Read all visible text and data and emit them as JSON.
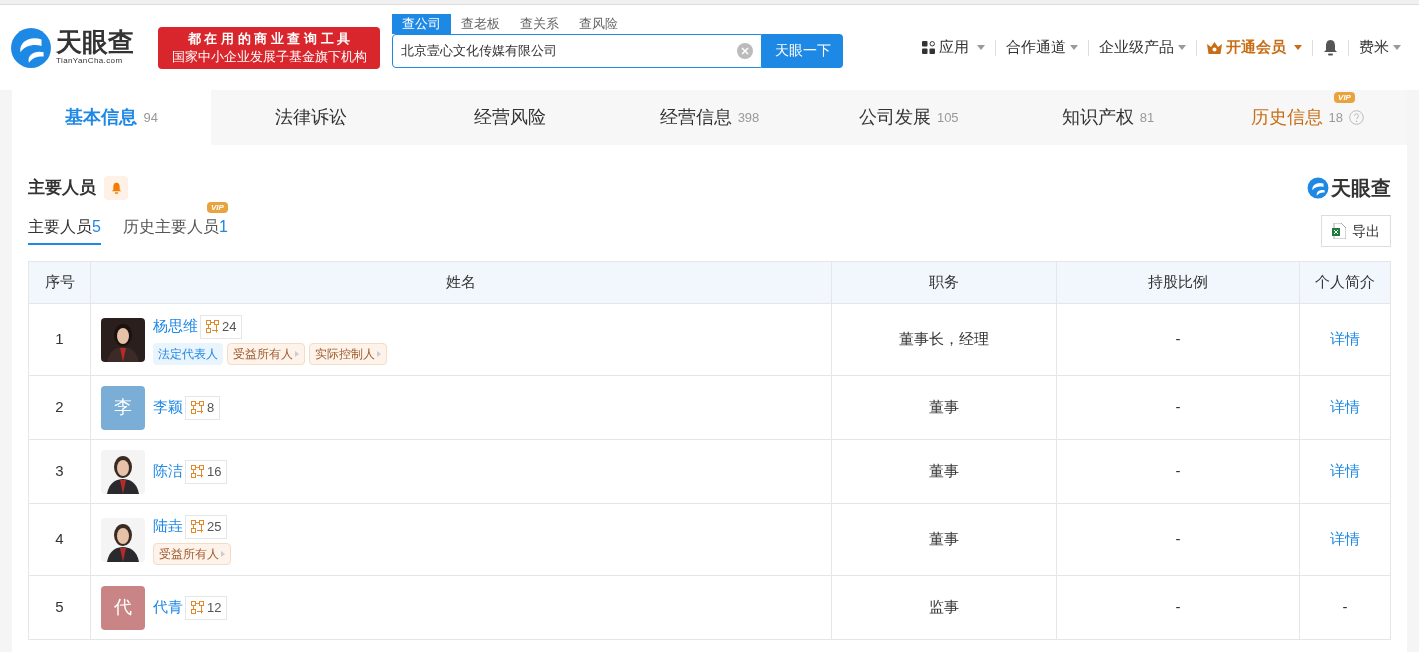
{
  "header": {
    "logo_text": "天眼查",
    "logo_domain": "TianYanCha.com",
    "banner": [
      "都 在 用 的 商 业 查 询 工 具",
      "国家中小企业发展子基金旗下机构"
    ],
    "search_tabs": [
      {
        "label": "查公司",
        "selected": true
      },
      {
        "label": "查老板",
        "selected": false
      },
      {
        "label": "查关系",
        "selected": false
      },
      {
        "label": "查风险",
        "selected": false
      }
    ],
    "search_value": "北京壹心文化传媒有限公司",
    "search_button": "天眼一下",
    "nav": [
      {
        "label": "应用",
        "kind": "apps"
      },
      {
        "label": "合作通道",
        "kind": "plain"
      },
      {
        "label": "企业级产品",
        "kind": "plain"
      },
      {
        "label": "开通会员",
        "kind": "vip"
      },
      {
        "kind": "bell"
      },
      {
        "label": "费米",
        "kind": "plain"
      }
    ]
  },
  "tabs": [
    {
      "label": "基本信息",
      "count": "94",
      "selected": true
    },
    {
      "label": "法律诉讼",
      "selected": false
    },
    {
      "label": "经营风险",
      "selected": false
    },
    {
      "label": "经营信息",
      "count": "398",
      "selected": false
    },
    {
      "label": "公司发展",
      "count": "105",
      "selected": false
    },
    {
      "label": "知识产权",
      "count": "81",
      "selected": false
    },
    {
      "label": "历史信息",
      "count": "18",
      "selected": false,
      "vip_badge": "VIP"
    }
  ],
  "section": {
    "title": "主要人员",
    "brand": "天眼查",
    "export": "导出",
    "subtabs": [
      {
        "label": "主要人员",
        "count": "5",
        "selected": true
      },
      {
        "label": "历史主要人员",
        "count": "1",
        "selected": false,
        "vip_badge": "VIP"
      }
    ],
    "table": {
      "columns": [
        "序号",
        "姓名",
        "职务",
        "持股比例",
        "个人简介"
      ],
      "rows": [
        {
          "index": "1",
          "avatar": {
            "kind": "picture"
          },
          "name": "杨思维",
          "relations": "24",
          "tags": [
            {
              "label": "法定代表人",
              "kind": "legal"
            },
            {
              "label": "受益所有人",
              "kind": "owner"
            },
            {
              "label": "实际控制人",
              "kind": "owner"
            }
          ],
          "position": "董事长，经理",
          "share": "-",
          "detail": "详情",
          "detail_link": true
        },
        {
          "index": "2",
          "avatar": {
            "kind": "initial",
            "text": "李",
            "color": "#7aaed6"
          },
          "name": "李颖",
          "relations": "8",
          "position": "董事",
          "share": "-",
          "detail": "详情",
          "detail_link": true
        },
        {
          "index": "3",
          "avatar": {
            "kind": "picture"
          },
          "name": "陈洁",
          "relations": "16",
          "position": "董事",
          "share": "-",
          "detail": "详情",
          "detail_link": true
        },
        {
          "index": "4",
          "avatar": {
            "kind": "picture"
          },
          "name": "陆垚",
          "relations": "25",
          "tags": [
            {
              "label": "受益所有人",
              "kind": "owner"
            }
          ],
          "position": "董事",
          "share": "-",
          "detail": "详情",
          "detail_link": true
        },
        {
          "index": "5",
          "avatar": {
            "kind": "initial",
            "text": "代",
            "color": "#c98585"
          },
          "name": "代青",
          "relations": "12",
          "position": "监事",
          "share": "-",
          "detail": "-",
          "detail_link": false
        }
      ]
    }
  }
}
